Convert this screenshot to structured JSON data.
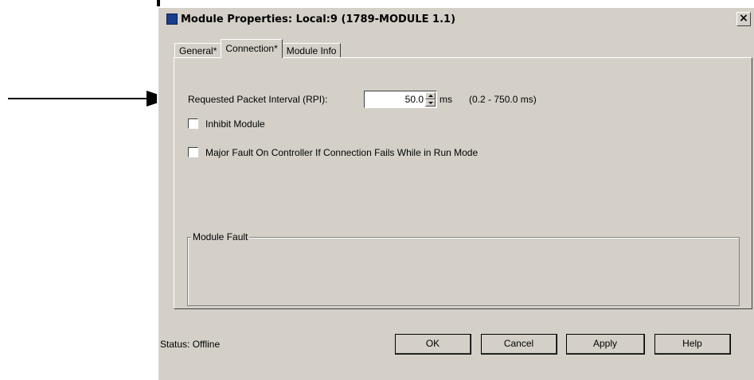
{
  "window": {
    "title": "Module Properties: Local:9 (1789-MODULE 1.1)",
    "close_glyph": "×"
  },
  "tabs": [
    {
      "label": "General*",
      "active": false
    },
    {
      "label": "Connection*",
      "active": true
    },
    {
      "label": "Module Info",
      "active": false
    }
  ],
  "connection": {
    "rpi_label": "Requested Packet Interval (RPI):",
    "rpi_value": "50.0",
    "rpi_unit": "ms",
    "rpi_range": "(0.2 - 750.0 ms)",
    "inhibit_label": "Inhibit Module",
    "inhibit_checked": false,
    "major_fault_label": "Major Fault On Controller If Connection Fails While in Run Mode",
    "major_fault_checked": false,
    "module_fault_group_label": "Module Fault"
  },
  "footer": {
    "status": "Status: Offline",
    "ok_label": "OK",
    "cancel_label": "Cancel",
    "apply_label": "Apply",
    "help_label": "Help"
  },
  "colors": {
    "dialog_bg": "#d4d0c8",
    "title_icon": "#1a3e8a"
  }
}
